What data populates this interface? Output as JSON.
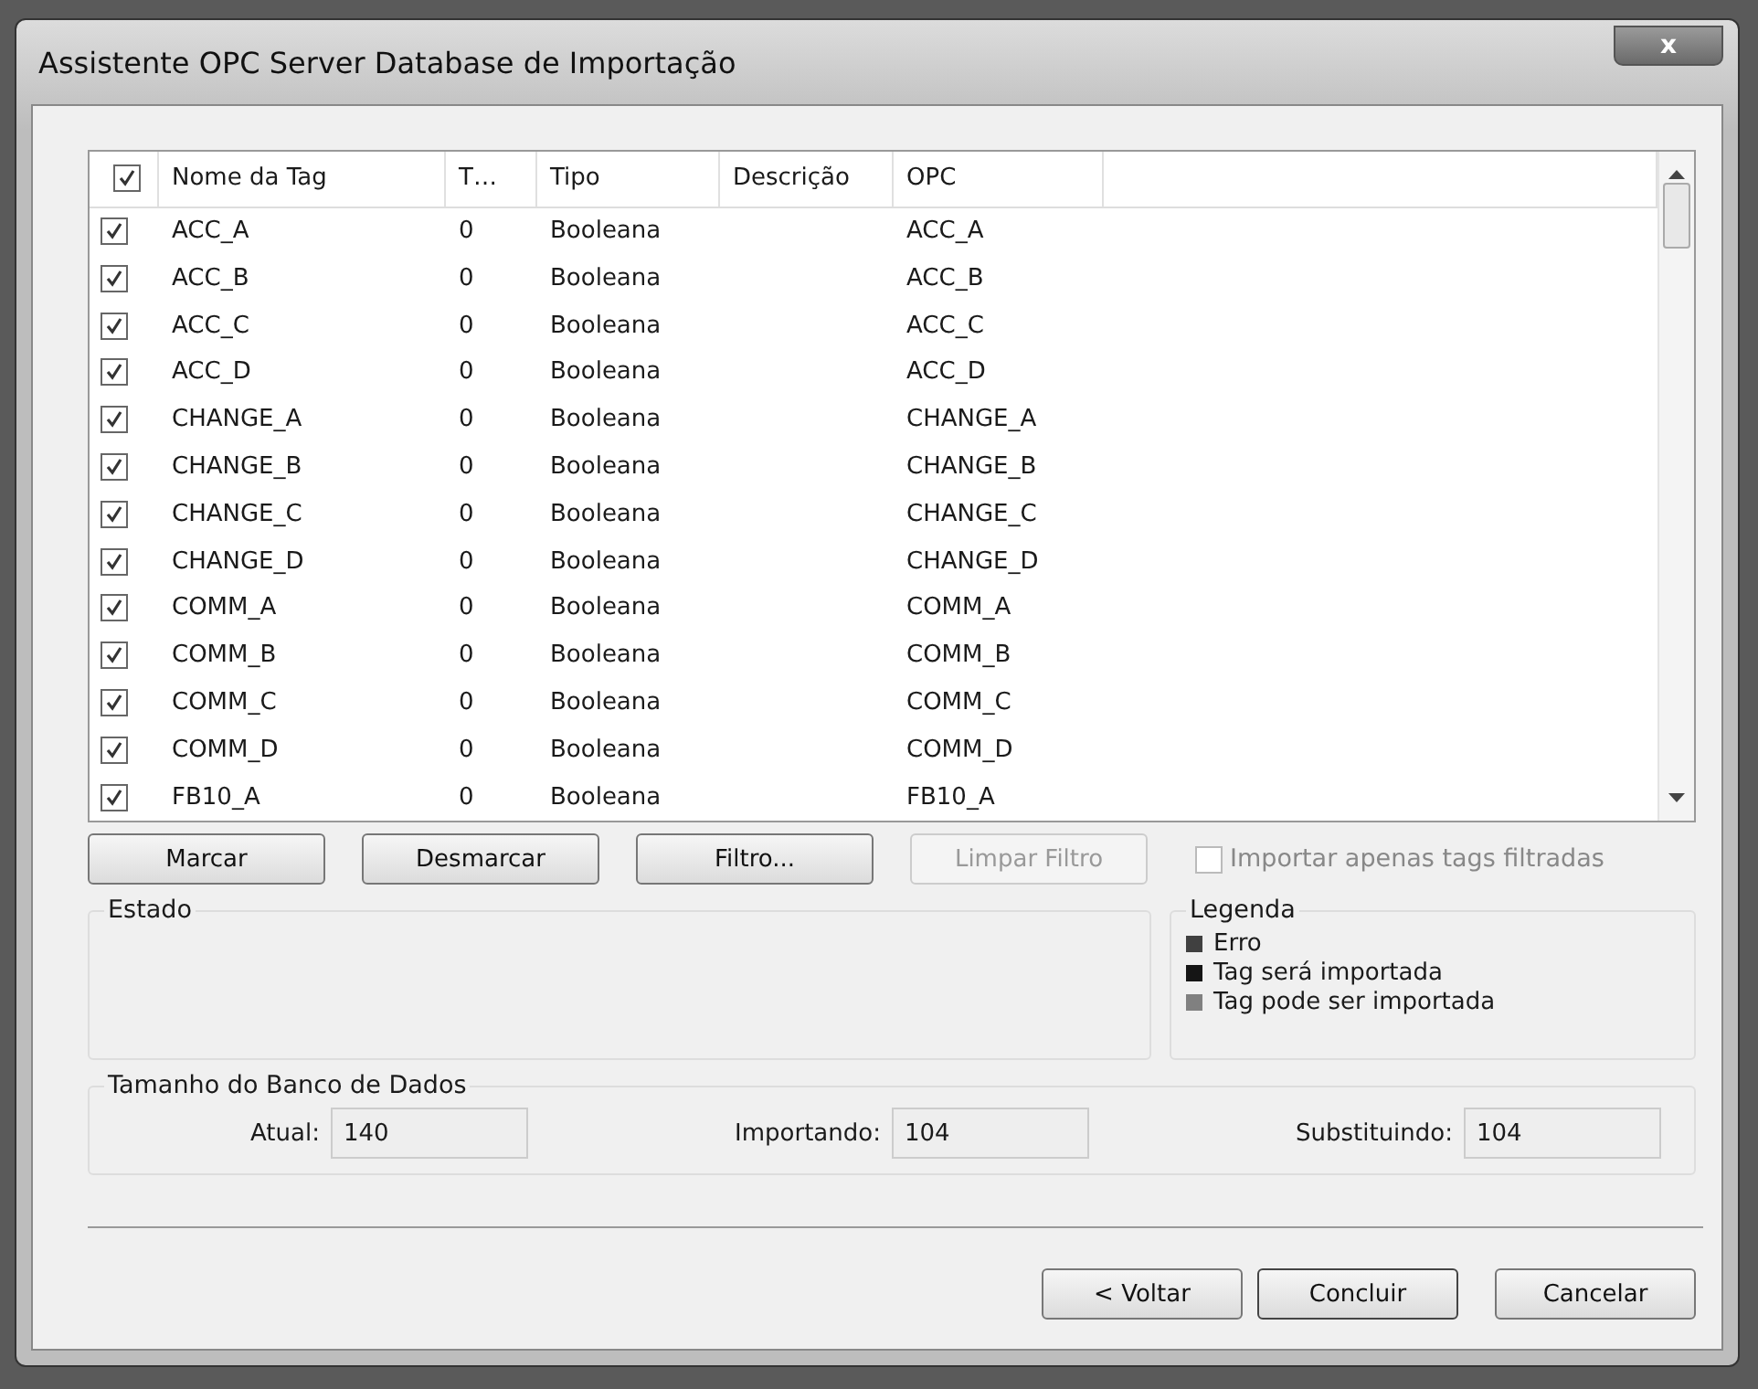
{
  "window": {
    "title": "Assistente OPC Server Database de Importação",
    "close": "x"
  },
  "table": {
    "all_checked": true,
    "columns": [
      "Nome da Tag",
      "T…",
      "Tipo",
      "Descrição",
      "OPC"
    ],
    "rows": [
      {
        "checked": true,
        "name": "ACC_A",
        "t": "0",
        "type": "Booleana",
        "opc": "ACC_A"
      },
      {
        "checked": true,
        "name": "ACC_B",
        "t": "0",
        "type": "Booleana",
        "opc": "ACC_B"
      },
      {
        "checked": true,
        "name": "ACC_C",
        "t": "0",
        "type": "Booleana",
        "opc": "ACC_C"
      },
      {
        "checked": true,
        "name": "ACC_D",
        "t": "0",
        "type": "Booleana",
        "opc": "ACC_D"
      },
      {
        "checked": true,
        "name": "CHANGE_A",
        "t": "0",
        "type": "Booleana",
        "opc": "CHANGE_A"
      },
      {
        "checked": true,
        "name": "CHANGE_B",
        "t": "0",
        "type": "Booleana",
        "opc": "CHANGE_B"
      },
      {
        "checked": true,
        "name": "CHANGE_C",
        "t": "0",
        "type": "Booleana",
        "opc": "CHANGE_C"
      },
      {
        "checked": true,
        "name": "CHANGE_D",
        "t": "0",
        "type": "Booleana",
        "opc": "CHANGE_D"
      },
      {
        "checked": true,
        "name": "COMM_A",
        "t": "0",
        "type": "Booleana",
        "opc": "COMM_A"
      },
      {
        "checked": true,
        "name": "COMM_B",
        "t": "0",
        "type": "Booleana",
        "opc": "COMM_B"
      },
      {
        "checked": true,
        "name": "COMM_C",
        "t": "0",
        "type": "Booleana",
        "opc": "COMM_C"
      },
      {
        "checked": true,
        "name": "COMM_D",
        "t": "0",
        "type": "Booleana",
        "opc": "COMM_D"
      },
      {
        "checked": true,
        "name": "FB10_A",
        "t": "0",
        "type": "Booleana",
        "opc": "FB10_A"
      }
    ]
  },
  "actions": [
    {
      "label": "Marcar",
      "disabled": false
    },
    {
      "label": "Desmarcar",
      "disabled": false
    },
    {
      "label": "Filtro...",
      "disabled": false
    },
    {
      "label": "Limpar Filtro",
      "disabled": true
    }
  ],
  "filter_option": {
    "label": "Importar apenas tags filtradas",
    "checked": false,
    "disabled": true
  },
  "status": {
    "title": "Estado"
  },
  "legend": {
    "title": "Legenda",
    "items": [
      {
        "label": "Erro",
        "color": "#404040"
      },
      {
        "label": "Tag será importada",
        "color": "#151515"
      },
      {
        "label": "Tag pode ser importada",
        "color": "#808080"
      }
    ]
  },
  "database_size": {
    "title": "Tamanho do Banco de Dados",
    "fields": [
      {
        "label": "Atual:",
        "value": "140"
      },
      {
        "label": "Importando:",
        "value": "104"
      },
      {
        "label": "Substituindo:",
        "value": "104"
      }
    ]
  },
  "buttons": [
    {
      "label": "< Voltar",
      "default": false
    },
    {
      "label": "Concluir",
      "default": true
    },
    {
      "label": "Cancelar",
      "default": false
    }
  ]
}
